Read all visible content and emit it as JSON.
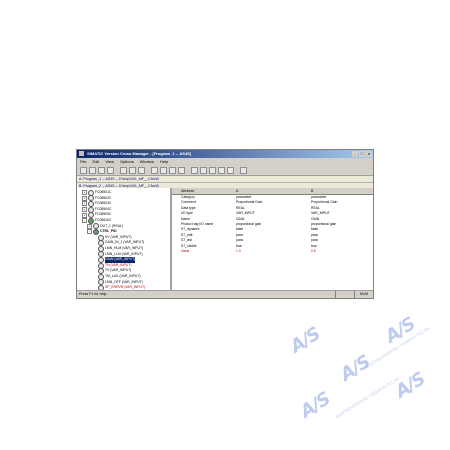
{
  "window": {
    "title": "SIMATIC Version Cross Manager - [Program_1 -- AS4S]",
    "controls": [
      "_",
      "□",
      "×"
    ]
  },
  "menu": [
    "File",
    "Edit",
    "View",
    "Options",
    "Window",
    "Help"
  ],
  "toolbar_icons": [
    "new-icon",
    "open-icon",
    "save-icon",
    "print-icon",
    "cut-icon",
    "copy-icon",
    "paste-icon",
    "first-icon",
    "prev-icon",
    "next-icon",
    "last-icon",
    "find-icon",
    "filter-icon",
    "view-icon",
    "view-icon",
    "view-icon",
    "help-icon"
  ],
  "paths": [
    "A: Program_1 -- AS4S -- D:\\tmp\\V01_MF__Cfov\\D",
    "B: Program_2 -- AS4S -- D:\\tmp\\V01_MF__Cfov\\D"
  ],
  "tree": [
    {
      "label": "FC08501C",
      "indent": 1,
      "expander": "+",
      "icon": "normal",
      "style": ""
    },
    {
      "label": "FC08502C",
      "indent": 1,
      "expander": "+",
      "icon": "normal",
      "style": ""
    },
    {
      "label": "FC08503C",
      "indent": 1,
      "expander": "+",
      "icon": "normal",
      "style": ""
    },
    {
      "label": "FC08504C",
      "indent": 1,
      "expander": "+",
      "icon": "normal",
      "style": ""
    },
    {
      "label": "FC08505C",
      "indent": 1,
      "expander": "+",
      "icon": "normal",
      "style": ""
    },
    {
      "label": "FC08510C",
      "indent": 1,
      "expander": "-",
      "icon": "green",
      "style": ""
    },
    {
      "label": "OUT_1 (REAL)",
      "indent": 2,
      "expander": "+",
      "icon": "normal",
      "style": ""
    },
    {
      "label": "CTRL_PID",
      "indent": 2,
      "expander": "-",
      "icon": "green",
      "style": "bold"
    },
    {
      "label": "KV (VAR_INPUT)",
      "indent": 3,
      "expander": "",
      "icon": "normal",
      "style": ""
    },
    {
      "label": "GAIN_IN_1 (VAR_INPUT)",
      "indent": 3,
      "expander": "",
      "icon": "normal",
      "style": ""
    },
    {
      "label": "LMN_HLM (VAR_INPUT)",
      "indent": 3,
      "expander": "",
      "icon": "normal",
      "style": ""
    },
    {
      "label": "LMN_LLM (VAR_INPUT)",
      "indent": 3,
      "expander": "",
      "icon": "normal",
      "style": ""
    },
    {
      "label": "GAIN (VAR_INPUT)",
      "indent": 3,
      "expander": "",
      "icon": "normal",
      "style": "selected"
    },
    {
      "label": "TN (VAR_INPUT)",
      "indent": 3,
      "expander": "",
      "icon": "normal",
      "style": "red"
    },
    {
      "label": "TV (VAR_INPUT)",
      "indent": 3,
      "expander": "",
      "icon": "normal",
      "style": ""
    },
    {
      "label": "TM_LAG (VAR_INPUT)",
      "indent": 3,
      "expander": "",
      "icon": "normal",
      "style": ""
    },
    {
      "label": "LMN_OFF (VAR_INPUT)",
      "indent": 3,
      "expander": "",
      "icon": "normal",
      "style": ""
    },
    {
      "label": "SP_ERRVR (VAR_INPUT)",
      "indent": 3,
      "expander": "",
      "icon": "normal",
      "style": "red"
    },
    {
      "label": "MAN_ON (VAR_INPUT)",
      "indent": 3,
      "expander": "",
      "icon": "normal",
      "style": ""
    },
    {
      "label": "MAN (VAR_INPUT)",
      "indent": 3,
      "expander": "",
      "icon": "normal",
      "style": ""
    },
    {
      "label": "PV_IN (VAR_INPUT)",
      "indent": 3,
      "expander": "",
      "icon": "normal",
      "style": ""
    },
    {
      "label": "SP_INT (VAR_INPUT)",
      "indent": 3,
      "expander": "",
      "icon": "normal",
      "style": ""
    }
  ],
  "grid": {
    "headers": [
      "Attribute",
      "A",
      "B"
    ],
    "rows": [
      {
        "attr": "Category",
        "a": "parameter",
        "b": "parameter",
        "style": ""
      },
      {
        "attr": "Comment",
        "a": "Proportional Gain",
        "b": "Proportional Gain",
        "style": ""
      },
      {
        "attr": "Data type",
        "a": "REAL",
        "b": "REAL",
        "style": ""
      },
      {
        "attr": "I/O type",
        "a": "VAR_INPUT",
        "b": "VAR_INPUT",
        "style": ""
      },
      {
        "attr": "Name",
        "a": "GAIN",
        "b": "GAIN",
        "style": ""
      },
      {
        "attr": "Product tag I/O name",
        "a": "proportional gain",
        "b": "proportional gain",
        "style": ""
      },
      {
        "attr": "S7_dynamic",
        "a": "false",
        "b": "false",
        "style": ""
      },
      {
        "attr": "S7_edit",
        "a": "para",
        "b": "para",
        "style": ""
      },
      {
        "attr": "S7_link",
        "a": "para",
        "b": "para",
        "style": ""
      },
      {
        "attr": "S7_visible",
        "a": "true",
        "b": "true",
        "style": ""
      },
      {
        "attr": "Value",
        "a": "1.0",
        "b": "0.5",
        "style": "red"
      }
    ]
  },
  "status": {
    "text": "Press F1 for help.",
    "cell1": "",
    "cell2": "NUM"
  },
  "watermark": {
    "text": "A/S",
    "url": "ELEKTRO-SHOP.DE / SIEMENS-PLC.DE"
  }
}
